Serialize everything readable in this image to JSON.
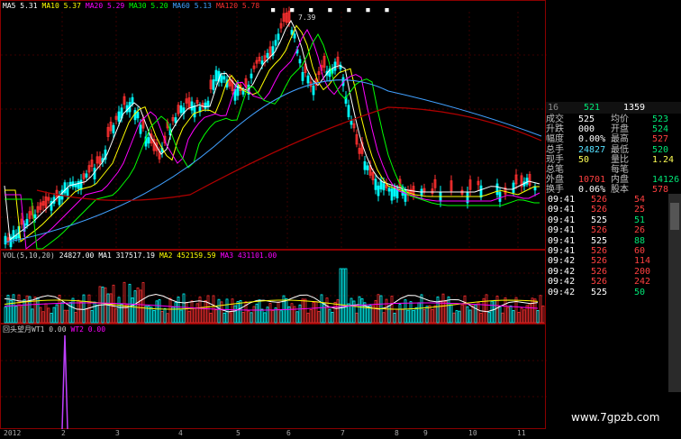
{
  "main_header": {
    "ma": "MA",
    "items": [
      {
        "label": "MA5 5.31",
        "color": "#ffffff"
      },
      {
        "label": "MA10 5.37",
        "color": "#ffff00"
      },
      {
        "label": "MA20 5.29",
        "color": "#ff00ff"
      },
      {
        "label": "MA30 5.20",
        "color": "#00ff00"
      },
      {
        "label": "MA60 5.13",
        "color": "#40a0ff"
      },
      {
        "label": "MA120 5.78",
        "color": "#ff3030"
      }
    ]
  },
  "high_label": "7.39",
  "vol_header": {
    "items": [
      {
        "label": "VOL(5,10,20)",
        "color": "#cccccc"
      },
      {
        "label": "24827.00",
        "color": "#ffffff"
      },
      {
        "label": "MA1 317517.19",
        "color": "#ffffff"
      },
      {
        "label": "MA2 452159.59",
        "color": "#ffff00"
      },
      {
        "label": "MA3 431101.00",
        "color": "#ff00ff"
      }
    ]
  },
  "ind_header": {
    "items": [
      {
        "label": "回头望月WT1 0.00",
        "color": "#cccccc"
      },
      {
        "label": "WT2 0.00",
        "color": "#ff00ff"
      }
    ]
  },
  "x_axis": [
    "2012",
    "2",
    "3",
    "4",
    "5",
    "6",
    "7",
    "8",
    "9",
    "10",
    "11"
  ],
  "quote_head": {
    "code": "16",
    "v1": "521",
    "v2": "1359"
  },
  "quote_rows": [
    {
      "l1": "成交",
      "v1": "525",
      "c1": "w",
      "l2": "均价",
      "v2": "523",
      "c2": "g"
    },
    {
      "l1": "升跌",
      "v1": "000",
      "c1": "w",
      "l2": "开盘",
      "v2": "524",
      "c2": "g"
    },
    {
      "l1": "幅度",
      "v1": "0.00%",
      "c1": "w",
      "l2": "最高",
      "v2": "527",
      "c2": "r"
    },
    {
      "l1": "总手",
      "v1": "24827",
      "c1": "c",
      "l2": "最低",
      "v2": "520",
      "c2": "g"
    },
    {
      "l1": "现手",
      "v1": "50",
      "c1": "y",
      "l2": "量比",
      "v2": "1.24",
      "c2": "y"
    },
    {
      "l1": "总笔",
      "v1": "",
      "c1": "w",
      "l2": "每笔",
      "v2": "",
      "c2": "w"
    },
    {
      "l1": "外盘",
      "v1": "10701",
      "c1": "r",
      "l2": "内盘",
      "v2": "14126",
      "c2": "g"
    },
    {
      "l1": "换手",
      "v1": "0.06%",
      "c1": "w",
      "l2": "股本",
      "v2": "578",
      "c2": "r"
    }
  ],
  "ticks": [
    {
      "time": "09:41",
      "price": "526",
      "pc": "r",
      "vol": "54",
      "vc": "r"
    },
    {
      "time": "09:41",
      "price": "526",
      "pc": "r",
      "vol": "25",
      "vc": "r"
    },
    {
      "time": "09:41",
      "price": "525",
      "pc": "w",
      "vol": "51",
      "vc": "g"
    },
    {
      "time": "09:41",
      "price": "526",
      "pc": "r",
      "vol": "26",
      "vc": "r"
    },
    {
      "time": "09:41",
      "price": "525",
      "pc": "w",
      "vol": "88",
      "vc": "g"
    },
    {
      "time": "09:41",
      "price": "526",
      "pc": "r",
      "vol": "60",
      "vc": "r"
    },
    {
      "time": "09:42",
      "price": "526",
      "pc": "r",
      "vol": "114",
      "vc": "r"
    },
    {
      "time": "09:42",
      "price": "526",
      "pc": "r",
      "vol": "200",
      "vc": "r"
    },
    {
      "time": "09:42",
      "price": "526",
      "pc": "r",
      "vol": "242",
      "vc": "r"
    },
    {
      "time": "09:42",
      "price": "525",
      "pc": "w",
      "vol": "50",
      "vc": "g"
    }
  ],
  "watermark": "www.7gpzb.com",
  "colors": {
    "up": "#ff3030",
    "down": "#00ffff",
    "border": "#8b0000"
  }
}
